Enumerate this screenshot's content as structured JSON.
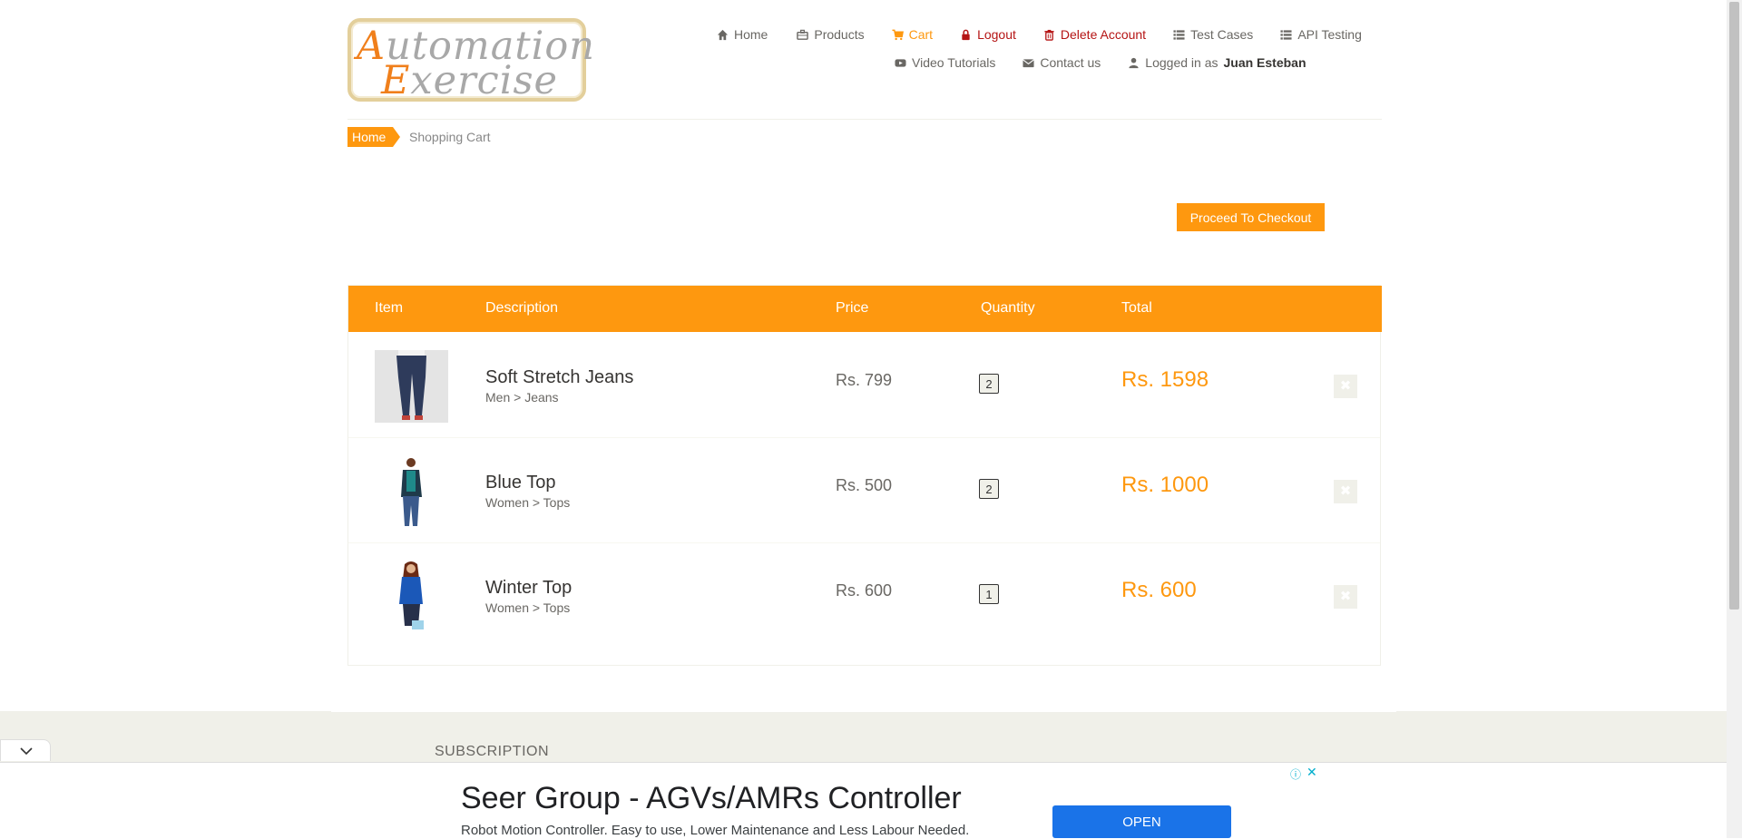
{
  "logo": {
    "line1_cap": "A",
    "line1_rest": "utomation",
    "line2_cap": "E",
    "line2_rest": "xercise"
  },
  "nav": {
    "home": "Home",
    "products": "Products",
    "cart": "Cart",
    "logout": "Logout",
    "delete_account": "Delete Account",
    "test_cases": "Test Cases",
    "api_testing": "API Testing",
    "video_tutorials": "Video Tutorials",
    "contact_us": "Contact us",
    "logged_in_prefix": "Logged in as",
    "username": "Juan Esteban"
  },
  "breadcrumb": {
    "home": "Home",
    "active": "Shopping Cart"
  },
  "checkout_label": "Proceed To Checkout",
  "table": {
    "headers": {
      "item": "Item",
      "description": "Description",
      "price": "Price",
      "quantity": "Quantity",
      "total": "Total"
    },
    "rows": [
      {
        "name": "Soft Stretch Jeans",
        "category": "Men > Jeans",
        "price": "Rs. 799",
        "quantity": "2",
        "total": "Rs. 1598",
        "delete_icon": "✖"
      },
      {
        "name": "Blue Top",
        "category": "Women > Tops",
        "price": "Rs. 500",
        "quantity": "2",
        "total": "Rs. 1000",
        "delete_icon": "✖"
      },
      {
        "name": "Winter Top",
        "category": "Women > Tops",
        "price": "Rs. 600",
        "quantity": "1",
        "total": "Rs. 600",
        "delete_icon": "✖"
      }
    ]
  },
  "footer": {
    "subscription": "SUBSCRIPTION"
  },
  "ad": {
    "title": "Seer Group - AGVs/AMRs Controller",
    "subtitle": "Robot Motion Controller. Easy to use, Lower Maintenance and Less Labour Needed.",
    "open_label": "OPEN",
    "info_icon": "ⓘ",
    "close_icon": "✕"
  },
  "colors": {
    "accent": "#FE980F",
    "danger": "#b51414",
    "text": "#696763"
  }
}
